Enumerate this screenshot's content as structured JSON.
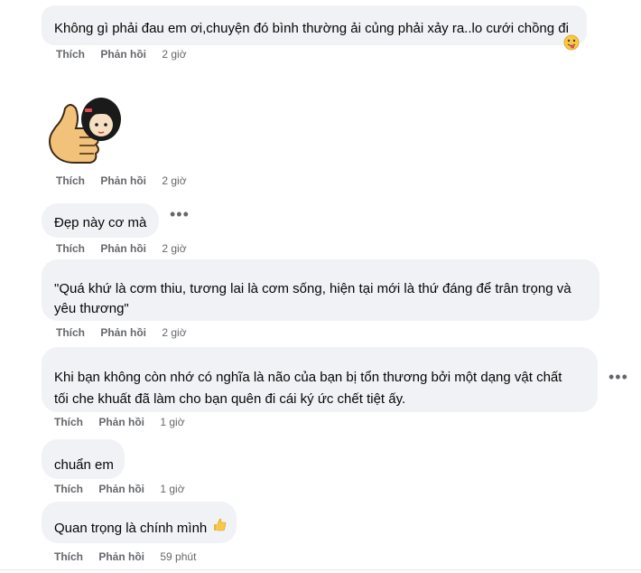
{
  "comments": [
    {
      "text": "Không gì phải đau em ơi,chuyện đó bình thường ải củng phải xảy ra..lo cưới chồng đi",
      "emoji": "tongue-out-emoji",
      "like": "Thích",
      "reply": "Phản hồi",
      "time": "2 giờ"
    },
    {
      "sticker": "thumbs-up-girl-sticker",
      "like": "Thích",
      "reply": "Phản hồi",
      "time": "2 giờ"
    },
    {
      "text": "Đẹp này cơ mà",
      "like": "Thích",
      "reply": "Phản hồi",
      "time": "2 giờ"
    },
    {
      "line1": "\"Quá khứ là cơm thiu, tương lai là cơm sống, hiện tại mới là thứ đáng để trân trọng và",
      "line2": "yêu thương\"",
      "like": "Thích",
      "reply": "Phản hồi",
      "time": "2 giờ"
    },
    {
      "line1": "Khi bạn không còn nhớ có nghĩa là não của bạn bị tổn thương bởi một dạng vật chất",
      "line2": "tối che khuất đã làm cho bạn quên đi cái ký ức chết tiệt ấy.",
      "like": "Thích",
      "reply": "Phản hồi",
      "time": "1 giờ"
    },
    {
      "text": "chuẩn em",
      "like": "Thích",
      "reply": "Phản hồi",
      "time": "1 giờ"
    },
    {
      "text": "Quan trọng là chính mình",
      "emoji": "thumbs-up-emoji",
      "like": "Thích",
      "reply": "Phản hồi",
      "time": "59 phút"
    }
  ],
  "colors": {
    "bubble": "#f0f2f5",
    "meta": "#65676b",
    "text": "#050505"
  }
}
